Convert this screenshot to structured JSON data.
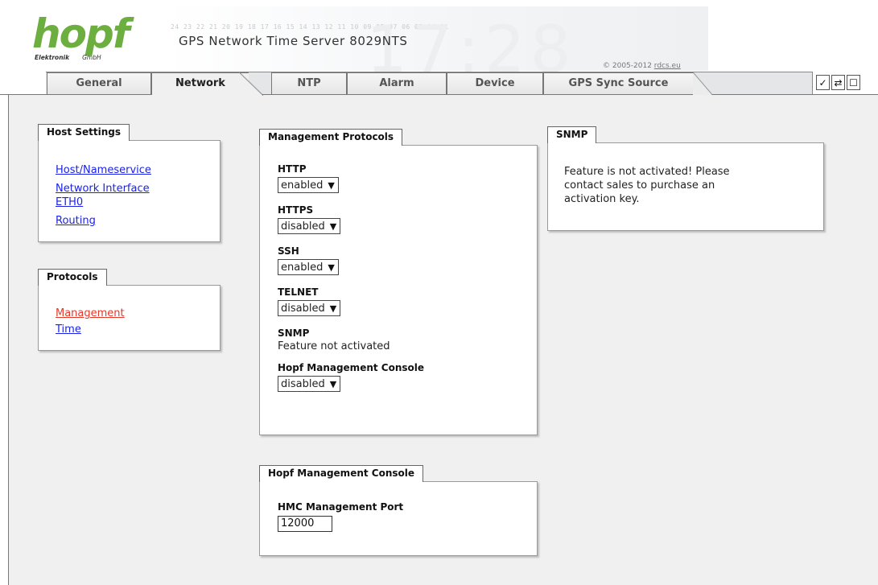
{
  "header": {
    "logo_text": "hopf",
    "logo_sub_left": "Elektronik",
    "logo_sub_right": "GmbH",
    "banner_digits": "24 23 22 21 20 19 18 17 16 15 14 13 12 11 10 09 08 07 06 05 04 01",
    "product_title": "GPS Network Time Server 8029NTS",
    "copyright_prefix": "© 2005-2012 ",
    "copyright_link": "rdcs.eu"
  },
  "tabs": [
    {
      "label": "General",
      "active": false
    },
    {
      "label": "Network",
      "active": true
    },
    {
      "label": "NTP",
      "active": false
    },
    {
      "label": "Alarm",
      "active": false
    },
    {
      "label": "Device",
      "active": false
    },
    {
      "label": "GPS Sync Source",
      "active": false
    }
  ],
  "toolbar": {
    "apply_icon": "check-icon",
    "reload_icon": "reload-icon",
    "save_icon": "save-icon"
  },
  "host_settings": {
    "title": "Host Settings",
    "links": [
      "Host/Nameservice",
      "Network Interface",
      "ETH0",
      "Routing"
    ]
  },
  "protocols": {
    "title": "Protocols",
    "links": [
      {
        "label": "Management",
        "active": true
      },
      {
        "label": "Time",
        "active": false
      }
    ]
  },
  "management_protocols": {
    "title": "Management Protocols",
    "fields": [
      {
        "label": "HTTP",
        "value": "enabled"
      },
      {
        "label": "HTTPS",
        "value": "disabled"
      },
      {
        "label": "SSH",
        "value": "enabled"
      },
      {
        "label": "TELNET",
        "value": "disabled"
      }
    ],
    "snmp_label": "SNMP",
    "snmp_text": "Feature not activated",
    "hmc_label": "Hopf Management Console",
    "hmc_value": "disabled"
  },
  "snmp": {
    "title": "SNMP",
    "message_line1": "Feature is not activated! Please",
    "message_line2": "contact sales to purchase an",
    "message_line3": "activation key."
  },
  "hmc": {
    "title": "Hopf Management Console",
    "port_label": "HMC Management Port",
    "port_value": "12000"
  },
  "colors": {
    "link": "#1a22e8",
    "link_active": "#e23a2a",
    "logo_green": "#6cae3f",
    "content_bg": "#f0f0f0"
  }
}
